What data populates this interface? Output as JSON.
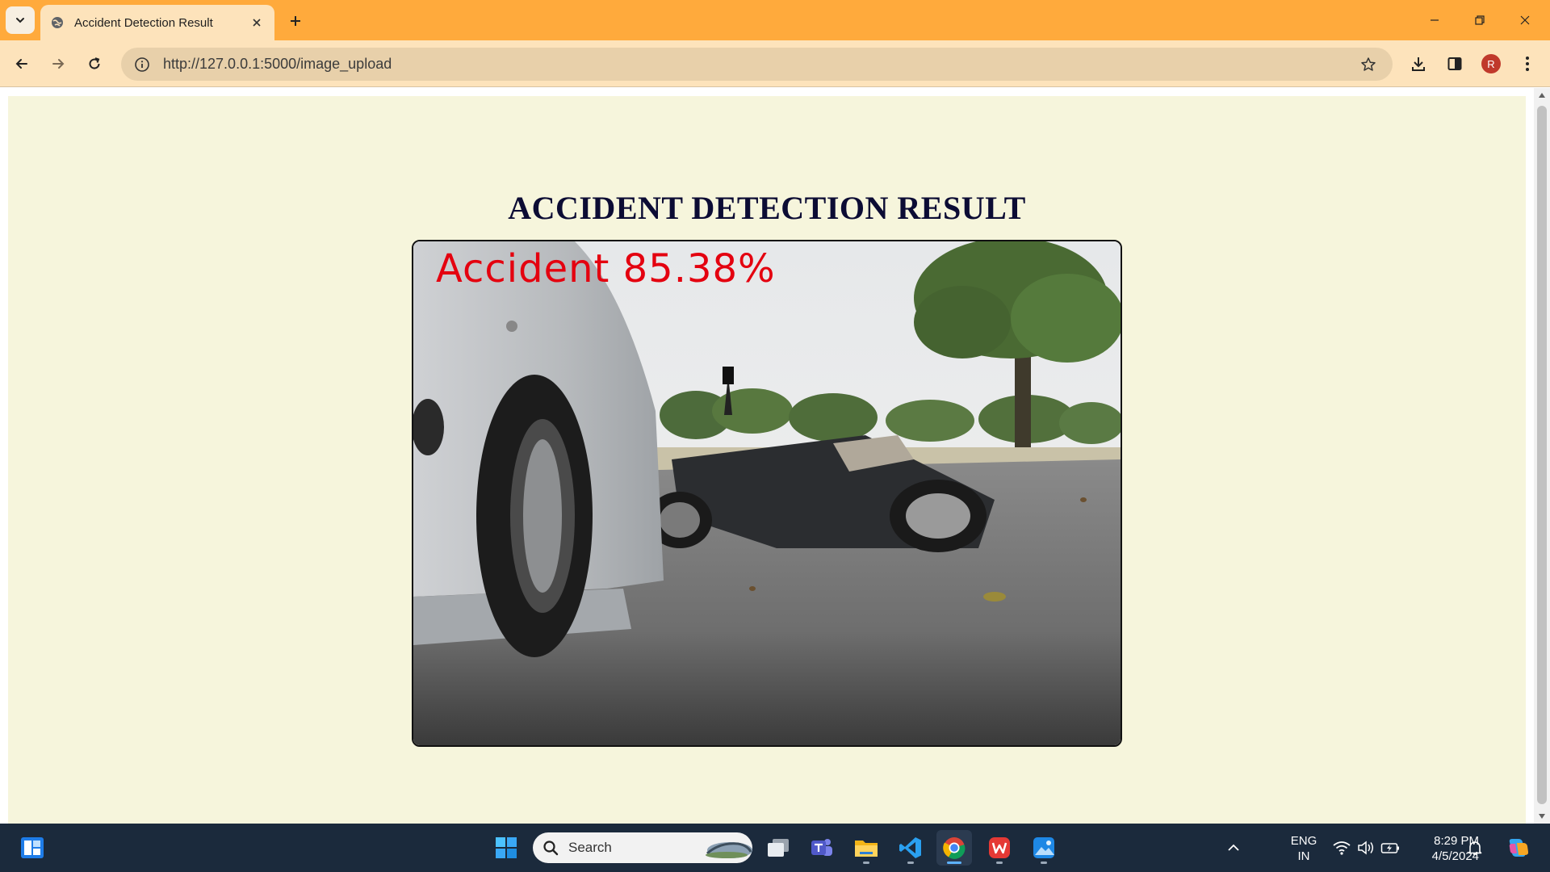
{
  "browser": {
    "tab_title": "Accident Detection Result",
    "url": "http://127.0.0.1:5000/image_upload",
    "profile_initial": "R",
    "accent_color": "#ffaa3c"
  },
  "page": {
    "title": "ACCIDENT DETECTION RESULT",
    "result_image": {
      "overlay_label": "Accident 85.38%",
      "label_color": "#e4000f"
    }
  },
  "taskbar": {
    "search_label": "Search",
    "apps": [
      "widgets-icon",
      "windows-start-icon",
      "task-view-icon",
      "teams-icon",
      "file-explorer-icon",
      "vscode-icon",
      "chrome-icon",
      "wps-office-icon",
      "photos-icon"
    ],
    "language_line1": "ENG",
    "language_line2": "IN",
    "time": "8:29 PM",
    "date": "4/5/2024"
  }
}
